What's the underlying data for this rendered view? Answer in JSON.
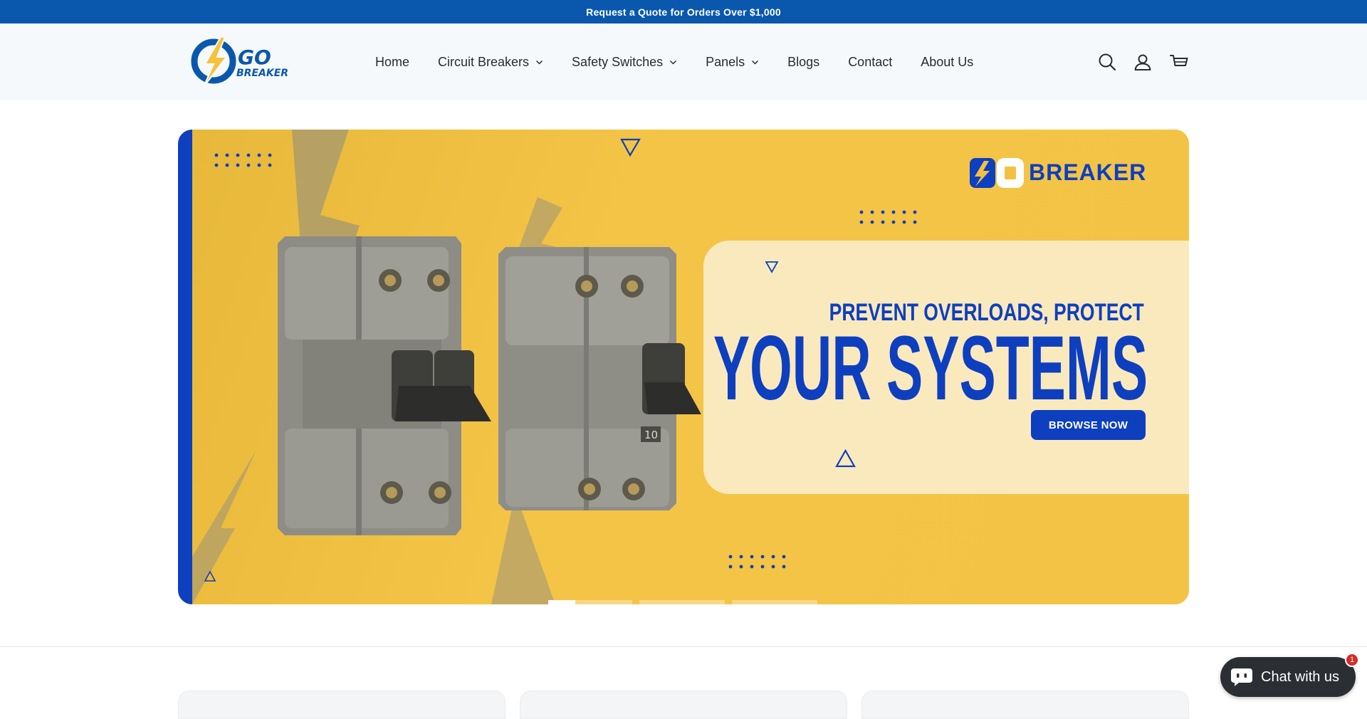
{
  "announcement": {
    "text": "Request a Quote for Orders Over $1,000"
  },
  "brand": {
    "logo_line1": "GO",
    "logo_line2": "BREAKER",
    "accent": "#0a58ad",
    "yellow": "#f3c142",
    "blue": "#0d3fbf"
  },
  "nav": {
    "items": [
      {
        "label": "Home",
        "dropdown": false
      },
      {
        "label": "Circuit Breakers",
        "dropdown": true
      },
      {
        "label": "Safety Switches",
        "dropdown": true
      },
      {
        "label": "Panels",
        "dropdown": true
      },
      {
        "label": "Blogs",
        "dropdown": false
      },
      {
        "label": "Contact",
        "dropdown": false
      },
      {
        "label": "About Us",
        "dropdown": false
      }
    ]
  },
  "header_icons": [
    "search-icon",
    "account-icon",
    "cart-icon"
  ],
  "hero": {
    "brand_text": "BREAKER",
    "subtitle": "PREVENT OVERLOADS, PROTECT",
    "title": "YOUR SYSTEMS",
    "button": "BROWSE NOW",
    "breaker_label": "10",
    "slides": 4,
    "active_slide": 1
  },
  "chat": {
    "label": "Chat with us",
    "badge": "1"
  }
}
